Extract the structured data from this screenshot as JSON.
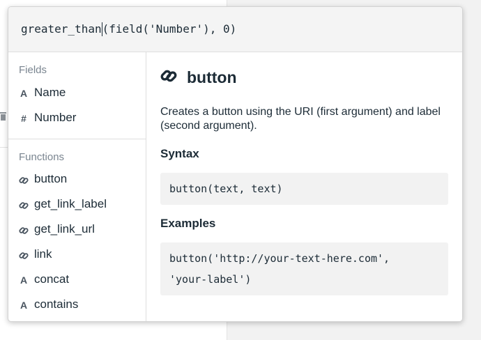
{
  "formula": {
    "before_caret": "greater_than",
    "after_caret": "(field('Number'), 0)"
  },
  "fields": {
    "title": "Fields",
    "items": [
      {
        "icon": "text-type-icon",
        "glyph": "A",
        "label": "Name"
      },
      {
        "icon": "number-type-icon",
        "glyph": "#",
        "label": "Number"
      }
    ]
  },
  "functions": {
    "title": "Functions",
    "items": [
      {
        "icon": "link-icon",
        "label": "button"
      },
      {
        "icon": "link-icon",
        "label": "get_link_label"
      },
      {
        "icon": "link-icon",
        "label": "get_link_url"
      },
      {
        "icon": "link-icon",
        "label": "link"
      },
      {
        "icon": "text-type-icon",
        "glyph": "A",
        "label": "concat"
      },
      {
        "icon": "text-type-icon",
        "glyph": "A",
        "label": "contains"
      }
    ]
  },
  "detail": {
    "icon": "link-icon",
    "title": "button",
    "description": "Creates a button using the URI (first argument) and label (second argument).",
    "syntax_heading": "Syntax",
    "syntax": "button(text, text)",
    "examples_heading": "Examples",
    "example_line1": "button('http://your-text-here.com',",
    "example_line2": "'your-label')"
  },
  "colors": {
    "text": "#1c2b36",
    "muted": "#7a8590",
    "code_bg": "#f2f2f2"
  }
}
